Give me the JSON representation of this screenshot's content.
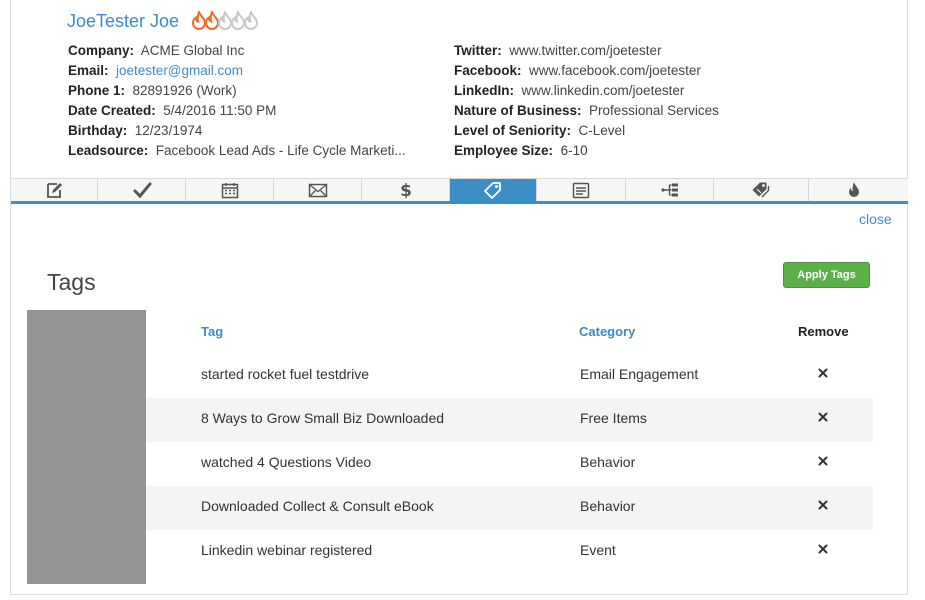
{
  "contact": {
    "name": "JoeTester Joe",
    "lead_score": {
      "filled": 2,
      "total": 5
    }
  },
  "info_left": [
    {
      "label": "Company:",
      "value": "ACME Global Inc",
      "link": false
    },
    {
      "label": "Email:",
      "value": "joetester@gmail.com",
      "link": true
    },
    {
      "label": "Phone 1:",
      "value": "82891926 (Work)",
      "link": false
    },
    {
      "label": "Date Created:",
      "value": "5/4/2016 11:50 PM",
      "link": false
    },
    {
      "label": "Birthday:",
      "value": "12/23/1974",
      "link": false
    },
    {
      "label": "Leadsource:",
      "value": "Facebook Lead Ads - Life Cycle Marketi...",
      "link": false
    }
  ],
  "info_right": [
    {
      "label": "Twitter:",
      "value": "www.twitter.com/joetester",
      "link": false
    },
    {
      "label": "Facebook:",
      "value": "www.facebook.com/joetester",
      "link": false
    },
    {
      "label": "LinkedIn:",
      "value": "www.linkedin.com/joetester",
      "link": false
    },
    {
      "label": "Nature of Business:",
      "value": "Professional Services",
      "link": false
    },
    {
      "label": "Level of Seniority:",
      "value": "C-Level",
      "link": false
    },
    {
      "label": "Employee Size:",
      "value": "6-10",
      "link": false
    }
  ],
  "tabs": [
    {
      "icon": "edit-icon",
      "active": false
    },
    {
      "icon": "checkmark-icon",
      "active": false
    },
    {
      "icon": "calendar-icon",
      "active": false
    },
    {
      "icon": "envelope-icon",
      "active": false
    },
    {
      "icon": "dollar-icon",
      "active": false
    },
    {
      "icon": "tag-icon",
      "active": true
    },
    {
      "icon": "form-icon",
      "active": false
    },
    {
      "icon": "sequence-icon",
      "active": false
    },
    {
      "icon": "tags-icon",
      "active": false
    },
    {
      "icon": "flame-icon",
      "active": false
    }
  ],
  "panel": {
    "close_label": "close",
    "title": "Tags",
    "apply_label": "Apply Tags"
  },
  "table": {
    "headers": {
      "tag": "Tag",
      "category": "Category",
      "remove": "Remove"
    },
    "rows": [
      {
        "tag": "started rocket fuel testdrive",
        "category": "Email Engagement"
      },
      {
        "tag": "8 Ways to Grow Small Biz Downloaded",
        "category": "Free Items"
      },
      {
        "tag": "watched 4 Questions Video",
        "category": "Behavior"
      },
      {
        "tag": "Downloaded Collect & Consult eBook",
        "category": "Behavior"
      },
      {
        "tag": "Linkedin webinar registered",
        "category": "Event"
      }
    ]
  },
  "colors": {
    "accent": "#3b8fc4",
    "link": "#3f8ac6",
    "apply_button": "#5bb049",
    "flame_active": "#f26b21",
    "flame_inactive": "#c8c8c8"
  }
}
